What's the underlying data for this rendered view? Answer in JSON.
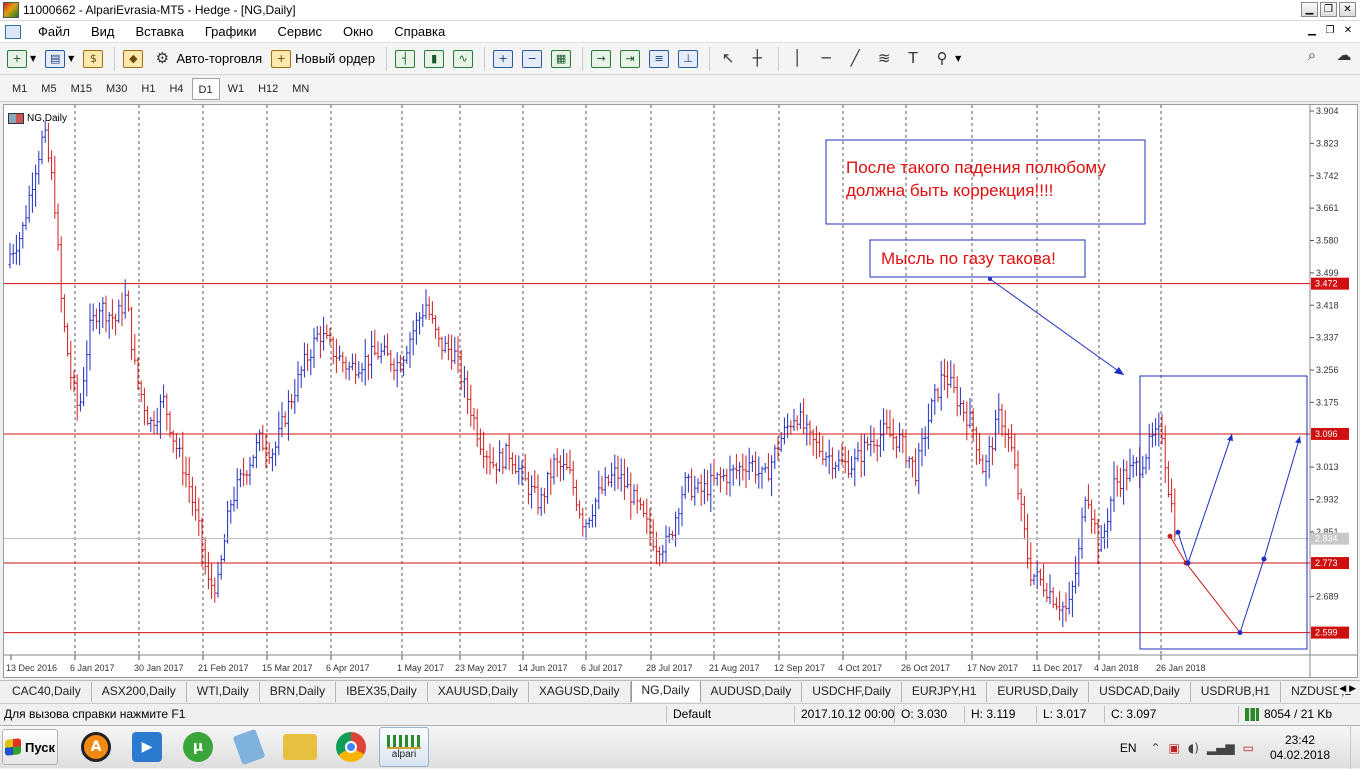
{
  "window": {
    "title": "11000662 - AlpariEvrasia-MT5 - Hedge - [NG,Daily]",
    "buttons": [
      "▁",
      "❐",
      "✕"
    ]
  },
  "menu": {
    "items": [
      "Файл",
      "Вид",
      "Вставка",
      "Графики",
      "Сервис",
      "Окно",
      "Справка"
    ],
    "mdi_buttons": [
      "▁",
      "❐",
      "✕"
    ]
  },
  "toolbar": {
    "autotrading_label": "Авто-торговля",
    "new_order_label": "Новый ордер"
  },
  "timeframes": {
    "items": [
      "M1",
      "M5",
      "M15",
      "M30",
      "H1",
      "H4",
      "D1",
      "W1",
      "H12",
      "MN"
    ],
    "active": "D1"
  },
  "chart": {
    "label": "NG,Daily",
    "annotation_correction": [
      "После такого падения полюбому",
      "должна быть коррекция!!!!"
    ],
    "annotation_thought": "Мысль по газу такова!",
    "price_levels": [
      3.904,
      3.823,
      3.742,
      3.661,
      3.58,
      3.499,
      3.418,
      3.337,
      3.256,
      3.175,
      3.094,
      3.013,
      2.932,
      2.851,
      2.77,
      2.689,
      2.608
    ],
    "y_tick_labels": [
      "3.904",
      "3.823",
      "3.742",
      "3.661",
      "3.580",
      "3.499",
      "3.418",
      "3.337",
      "3.256",
      "3.175",
      "3.013",
      "2.932",
      "2.851",
      "2.689"
    ],
    "hlines": [
      {
        "price": 3.472,
        "label": "3.472"
      },
      {
        "price": 3.096,
        "label": "3.096"
      },
      {
        "price": 2.773,
        "label": "2.773"
      },
      {
        "price": 2.599,
        "label": "2.599"
      }
    ],
    "current_price": {
      "price": 2.834,
      "label": "2.834"
    },
    "date_labels": [
      "13 Dec 2016",
      "6 Jan 2017",
      "30 Jan 2017",
      "21 Feb 2017",
      "15 Mar 2017",
      "6 Apr 2017",
      "1 May 2017",
      "23 May 2017",
      "14 Jun 2017",
      "6 Jul 2017",
      "28 Jul 2017",
      "21 Aug 2017",
      "12 Sep 2017",
      "4 Oct 2017",
      "26 Oct 2017",
      "17 Nov 2017",
      "11 Dec 2017",
      "4 Jan 2018",
      "26 Jan 2018"
    ],
    "colors": {
      "bull": "#1f2fbf",
      "bear": "#cc1f1f",
      "level": "#d01010",
      "annotation_text": "#e01010",
      "annotation_border": "#1f2fbf"
    }
  },
  "symbol_tabs": {
    "items": [
      "CAC40,Daily",
      "ASX200,Daily",
      "WTI,Daily",
      "BRN,Daily",
      "IBEX35,Daily",
      "XAUUSD,Daily",
      "XAGUSD,Daily",
      "NG,Daily",
      "AUDUSD,Daily",
      "USDCHF,Daily",
      "EURJPY,H1",
      "EURUSD,Daily",
      "USDCAD,Daily",
      "USDRUB,H1",
      "NZDUSD,D"
    ],
    "active": "NG,Daily",
    "arrows": "◀ ▶"
  },
  "status": {
    "help": "Для вызова справки нажмите F1",
    "profile": "Default",
    "datetime": "2017.10.12 00:00",
    "open": "O: 3.030",
    "high": "H: 3.119",
    "low": "L: 3.017",
    "close": "C: 3.097",
    "traffic": "8054 / 21 Kb"
  },
  "taskbar": {
    "start_label": "Пуск",
    "active_app_label": "alpari",
    "lang": "EN",
    "time": "23:42",
    "date": "04.02.2018"
  }
}
